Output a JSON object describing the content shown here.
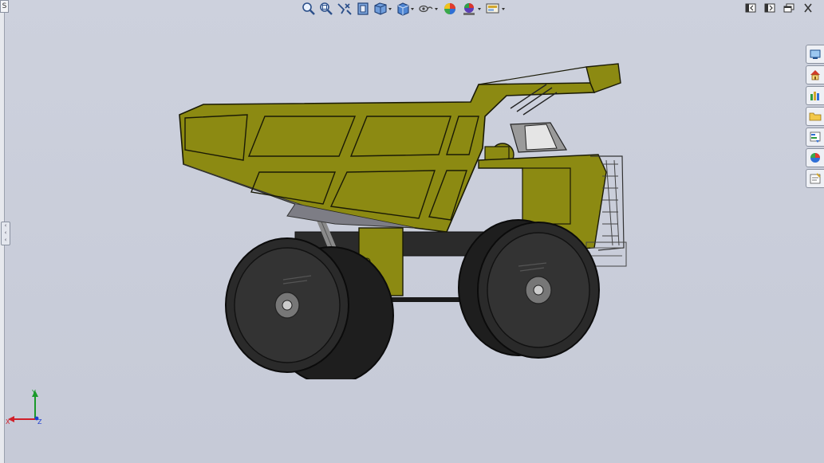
{
  "window": {
    "left_tab_label": "S"
  },
  "heads_up_toolbar": {
    "items": [
      {
        "icon": "zoom-to-fit-icon"
      },
      {
        "icon": "zoom-to-area-icon"
      },
      {
        "icon": "previous-view-icon"
      },
      {
        "icon": "section-view-icon"
      },
      {
        "icon": "view-orientation-icon",
        "dropdown": true
      },
      {
        "icon": "display-style-icon",
        "dropdown": true
      },
      {
        "icon": "hide-show-items-icon",
        "dropdown": true
      },
      {
        "icon": "edit-appearance-icon"
      },
      {
        "icon": "apply-scene-icon",
        "dropdown": true
      },
      {
        "icon": "view-settings-icon",
        "dropdown": true
      }
    ]
  },
  "window_controls": [
    "tile-horizontal-icon",
    "tile-vertical-icon",
    "restore-icon",
    "close-icon"
  ],
  "task_pane": [
    "resources-icon",
    "home-icon",
    "design-library-icon",
    "file-explorer-icon",
    "view-palette-icon",
    "appearances-icon",
    "custom-properties-icon"
  ],
  "triad": {
    "x_label": "X",
    "y_label": "Y",
    "z_label": "Z"
  },
  "colors": {
    "viewport_bg": "#c8ccd9",
    "body_olive": "#8c8a12",
    "tire": "#2a2a2a"
  }
}
